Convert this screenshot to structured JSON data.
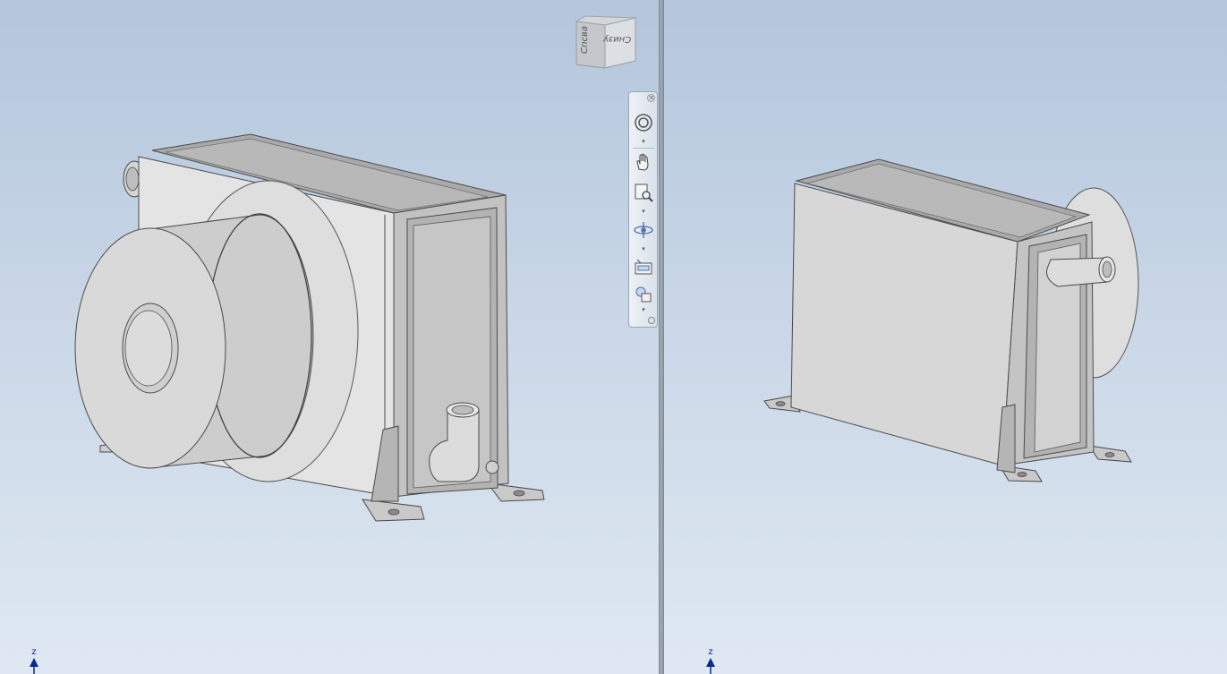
{
  "viewcube": {
    "front_label": "Спсва",
    "bottom_label": "Снизу"
  },
  "navbar": {
    "tools": [
      {
        "name": "steering-wheel-icon"
      },
      {
        "name": "pan-icon"
      },
      {
        "name": "zoom-icon"
      },
      {
        "name": "orbit-icon"
      },
      {
        "name": "look-at-icon"
      },
      {
        "name": "view-face-icon"
      }
    ]
  },
  "triads": {
    "left_axis": "z",
    "right_axis": "z"
  },
  "colors": {
    "background_top": "#b4c6dc",
    "background_bottom": "#dfe8f2",
    "model_light": "#e6e6e6",
    "model_mid": "#c8c8c8",
    "model_dark": "#9c9c9c",
    "edge": "#4a4a4a",
    "triad": "#0a2a8a"
  }
}
